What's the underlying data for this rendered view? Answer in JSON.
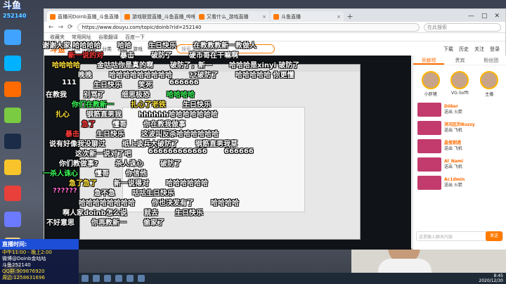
{
  "logo": {
    "text": "斗鱼",
    "sub": "252140"
  },
  "browser": {
    "tabs": [
      {
        "label": "直播间Doinb直播_斗鱼直播"
      },
      {
        "label": "游戏联盟直播_斗鱼直播_哔哩哔哩"
      },
      {
        "label": "又看什么_游戏直播"
      },
      {
        "label": "斗鱼直播"
      }
    ],
    "url": "https://www.douyu.com/topic/doinb?rid=252140",
    "search_placeholder": "在此搜索",
    "bookmarks": [
      "收藏夹",
      "常用网址",
      "谷歌翻译",
      "百度一下"
    ],
    "controls": {
      "min": "—",
      "max": "□",
      "close": "✕"
    }
  },
  "douyu": {
    "logo": "斗鱼",
    "nav": [
      "首页",
      "直播",
      "分类",
      "视频",
      "游戏"
    ],
    "search_placeholder": "搜索主播/直播间",
    "right": [
      "下载",
      "历史",
      "关注",
      "登录"
    ]
  },
  "sidebar": {
    "tabs": [
      "贡献榜",
      "贵宾",
      "粉丝团"
    ],
    "avatars": [
      {
        "name": "小胖猪"
      },
      {
        "name": "VG-Sofft"
      },
      {
        "name": "主播"
      }
    ],
    "rows": [
      {
        "user": "Dőker",
        "text": "送出 火箭"
      },
      {
        "user": "消况区的Buzzy",
        "text": "送出 飞机"
      },
      {
        "user": "晶莹剔透",
        "text": "送出 飞机"
      },
      {
        "user": "Al_Nami",
        "text": "送出 飞机"
      },
      {
        "user": "Ac1dmin",
        "text": "送出 火箭"
      }
    ],
    "chat_placeholder": "这里输入聊天内容",
    "send": "发送"
  },
  "danmaku": [
    {
      "text": "谢谢大家 哈哈哈哈",
      "cls": "white"
    },
    {
      "text": "新一说的对",
      "cls": "red"
    },
    {
      "text": "哈哈哈哈",
      "cls": "yellow"
    },
    {
      "text": "晚晚",
      "cls": "white"
    },
    {
      "text": "111",
      "cls": "white"
    },
    {
      "text": "在教我",
      "cls": "white"
    },
    {
      "text": "你们在教新一",
      "cls": "green"
    },
    {
      "text": "扎心",
      "cls": "yellow"
    },
    {
      "text": "急了",
      "cls": "red"
    },
    {
      "text": "暴击",
      "cls": "red"
    },
    {
      "text": "说有好像我没聊过",
      "cls": "white"
    },
    {
      "text": "这次新一说对了吧",
      "cls": "white"
    },
    {
      "text": "你们教做事?",
      "cls": "white"
    },
    {
      "text": "一杀人诛心",
      "cls": "green"
    },
    {
      "text": "急了急了",
      "cls": "yellow"
    },
    {
      "text": "??????",
      "cls": "pink"
    },
    {
      "text": "哈哈哈哈哈哈哈哈",
      "cls": "white"
    },
    {
      "text": "啊人家doinb怎么说",
      "cls": "white"
    },
    {
      "text": "不好意思",
      "cls": "white"
    },
    {
      "text": "哈哈",
      "cls": "white"
    },
    {
      "text": "暴击",
      "cls": "white"
    },
    {
      "text": "金咕咕你是真的啊",
      "cls": "white"
    },
    {
      "text": "哈哈哈哈哈哈哈哈哈",
      "cls": "white"
    },
    {
      "text": "生日快乐",
      "cls": "white"
    },
    {
      "text": "别骂了",
      "cls": "white"
    },
    {
      "text": "扎心了老铁",
      "cls": "yellow"
    },
    {
      "text": "钢筋直男我",
      "cls": "white"
    },
    {
      "text": "懂哥",
      "cls": "white"
    },
    {
      "text": "生日快乐",
      "cls": "white"
    },
    {
      "text": "纸上谈兵大破防了",
      "cls": "white"
    },
    {
      "text": "666666666666",
      "cls": "white"
    },
    {
      "text": "杀人诛心",
      "cls": "white"
    },
    {
      "text": "懂哥",
      "cls": "white"
    },
    {
      "text": "新一说得对",
      "cls": "white"
    },
    {
      "text": "急不急",
      "cls": "white"
    },
    {
      "text": "你也决发有了",
      "cls": "white"
    },
    {
      "text": "就去",
      "cls": "white"
    },
    {
      "text": "你再教新一",
      "cls": "white"
    },
    {
      "text": "生日快乐",
      "cls": "white"
    },
    {
      "text": "破防了",
      "cls": "white"
    },
    {
      "text": "破防了，新一",
      "cls": "white"
    },
    {
      "text": "??破防了",
      "cls": "white"
    },
    {
      "text": "笑死",
      "cls": "white"
    },
    {
      "text": "细思极恐",
      "cls": "white"
    },
    {
      "text": "生日快乐",
      "cls": "white"
    },
    {
      "text": "hhhhhh哈哈哈哈哈哈哈",
      "cls": "white"
    },
    {
      "text": "你在教我做事",
      "cls": "white"
    },
    {
      "text": "这波叫反杀哈哈哈哈哈哈",
      "cls": "white"
    },
    {
      "text": "钢筋直男我草",
      "cls": "white"
    },
    {
      "text": "666666",
      "cls": "white"
    },
    {
      "text": "破防了",
      "cls": "white"
    },
    {
      "text": "你信他",
      "cls": "white"
    },
    {
      "text": "哈哈哈哈哈哈",
      "cls": "white"
    },
    {
      "text": "咕咕生日快乐",
      "cls": "white"
    },
    {
      "text": "哈哈哈哈",
      "cls": "white"
    },
    {
      "text": "生日快乐",
      "cls": "white"
    },
    {
      "text": "偷家了",
      "cls": "white"
    },
    {
      "text": "在教教教新一教做人",
      "cls": "white"
    },
    {
      "text": "硬币哥在干嘛啊",
      "cls": "white"
    },
    {
      "text": "哈哈哈是xinyi 破防了",
      "cls": "white"
    },
    {
      "text": "哈哈哈哈哈 你更懂",
      "cls": "white"
    },
    {
      "text": "666666",
      "cls": "white"
    },
    {
      "text": "哈哈哈哈",
      "cls": "green"
    }
  ],
  "info": {
    "head": "直播时间:",
    "lines": [
      "中午11:00 - 晚上2:00",
      "微博@Doinb金咕咕",
      "斗鱼252140",
      "QQ群:909876920",
      "周边:1258631696"
    ]
  },
  "taskbar": {
    "time": "8:45",
    "date": "2020/12/30"
  }
}
